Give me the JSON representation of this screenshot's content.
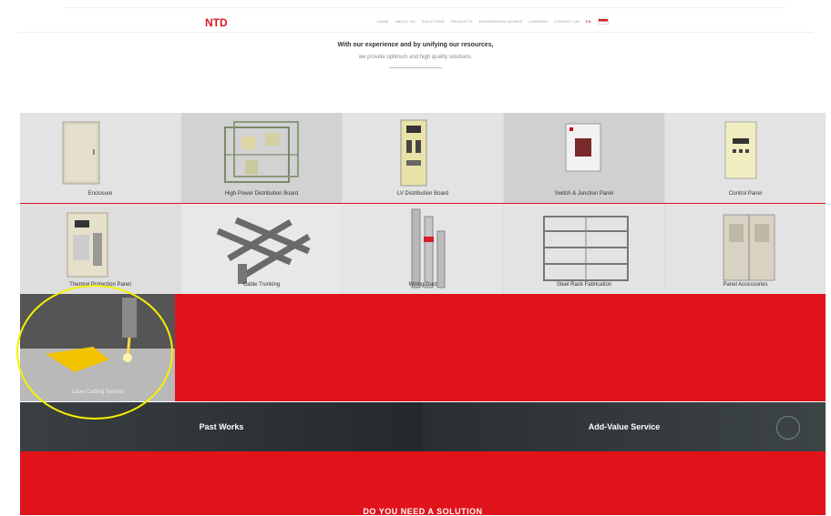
{
  "header": {
    "logo": "NTD",
    "nav": [
      "HOME",
      "ABOUT US",
      "SOLUTIONS",
      "PRODUCTS",
      "ENGINEERING WORKS",
      "CAREERS",
      "CONTACT US"
    ],
    "lang": "EN"
  },
  "hero": {
    "line1": "With our experience and by unifying our resources,",
    "line2": "we provide optimum and high quality solutions."
  },
  "products": {
    "row1": [
      {
        "label": "Enclosure"
      },
      {
        "label": "High Power Distribution Board"
      },
      {
        "label": "LV Distribution Board"
      },
      {
        "label": "Switch & Junction Panel"
      },
      {
        "label": "Control Panel"
      }
    ],
    "row2": [
      {
        "label": "Thermal Protection Panel"
      },
      {
        "label": "Cable Trunking"
      },
      {
        "label": "Wiring Duct"
      },
      {
        "label": "Steel Rack Fabrication"
      },
      {
        "label": "Panel Accessories"
      }
    ],
    "row3": [
      {
        "label": "Laser Cutting Service"
      }
    ]
  },
  "band": {
    "left": "Past Works",
    "right": "Add-Value Service"
  },
  "cta": {
    "title": "DO YOU NEED A SOLUTION"
  },
  "colors": {
    "brand_red": "#e0131b",
    "highlight": "#f5f000"
  }
}
